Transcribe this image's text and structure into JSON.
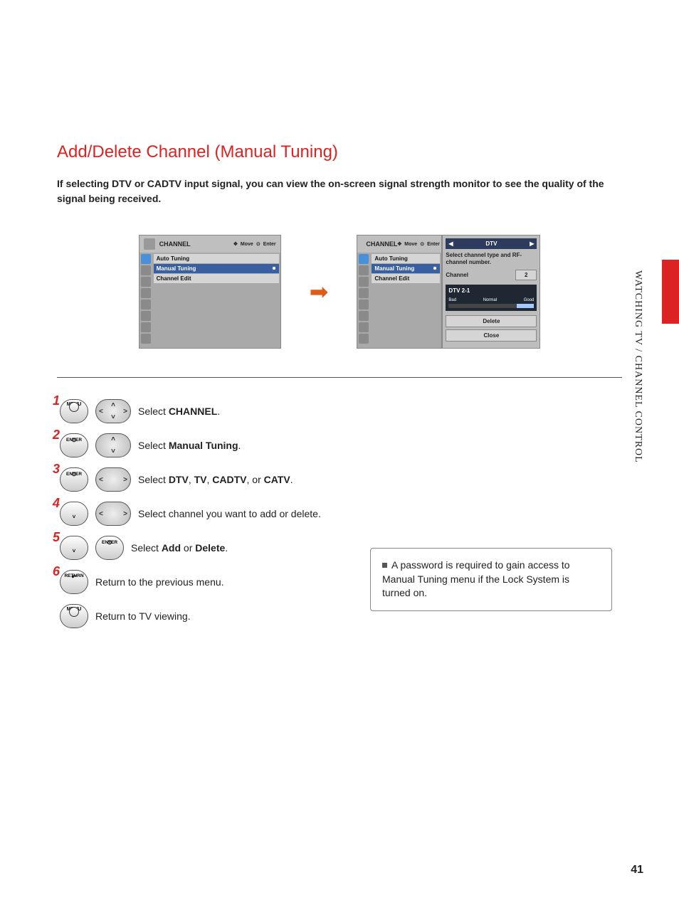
{
  "title": "Add/Delete Channel (Manual Tuning)",
  "intro": "If selecting DTV or CADTV input signal, you can view the on-screen signal strength monitor to see the quality of the signal being received.",
  "side_text": "WATCHING TV / CHANNEL CONTROL",
  "page_number": "41",
  "osd": {
    "header_title": "CHANNEL",
    "header_move": "Move",
    "header_enter": "Enter",
    "items": [
      "Auto Tuning",
      "Manual Tuning",
      "Channel Edit"
    ]
  },
  "panel": {
    "signal": "DTV",
    "note": "Select channel type and RF-channel number.",
    "channel_label": "Channel",
    "channel_value": "2",
    "dtv_label": "DTV 2-1",
    "bar_labels": [
      "Bad",
      "Normal",
      "Good"
    ],
    "delete_btn": "Delete",
    "close_btn": "Close"
  },
  "buttons": {
    "menu": "MENU",
    "enter": "ENTER",
    "return": "RETURN"
  },
  "steps": {
    "s1_pre": "Select ",
    "s1_b": "CHANNEL",
    "s2_pre": "Select ",
    "s2_b": "Manual Tuning",
    "s3_pre": "Select ",
    "s3_b1": "DTV",
    "s3_m1": ", ",
    "s3_b2": "TV",
    "s3_m2": ", ",
    "s3_b3": "CADTV",
    "s3_m3": ", or ",
    "s3_b4": "CATV",
    "s4": "Select channel you want to add or delete.",
    "s5_pre": "Select ",
    "s5_b1": "Add",
    "s5_m": " or ",
    "s5_b2": "Delete",
    "s6": "Return to the previous menu.",
    "s7": "Return to TV viewing."
  },
  "note": "A password is required to gain access to Manual Tuning menu if the Lock System is turned on."
}
